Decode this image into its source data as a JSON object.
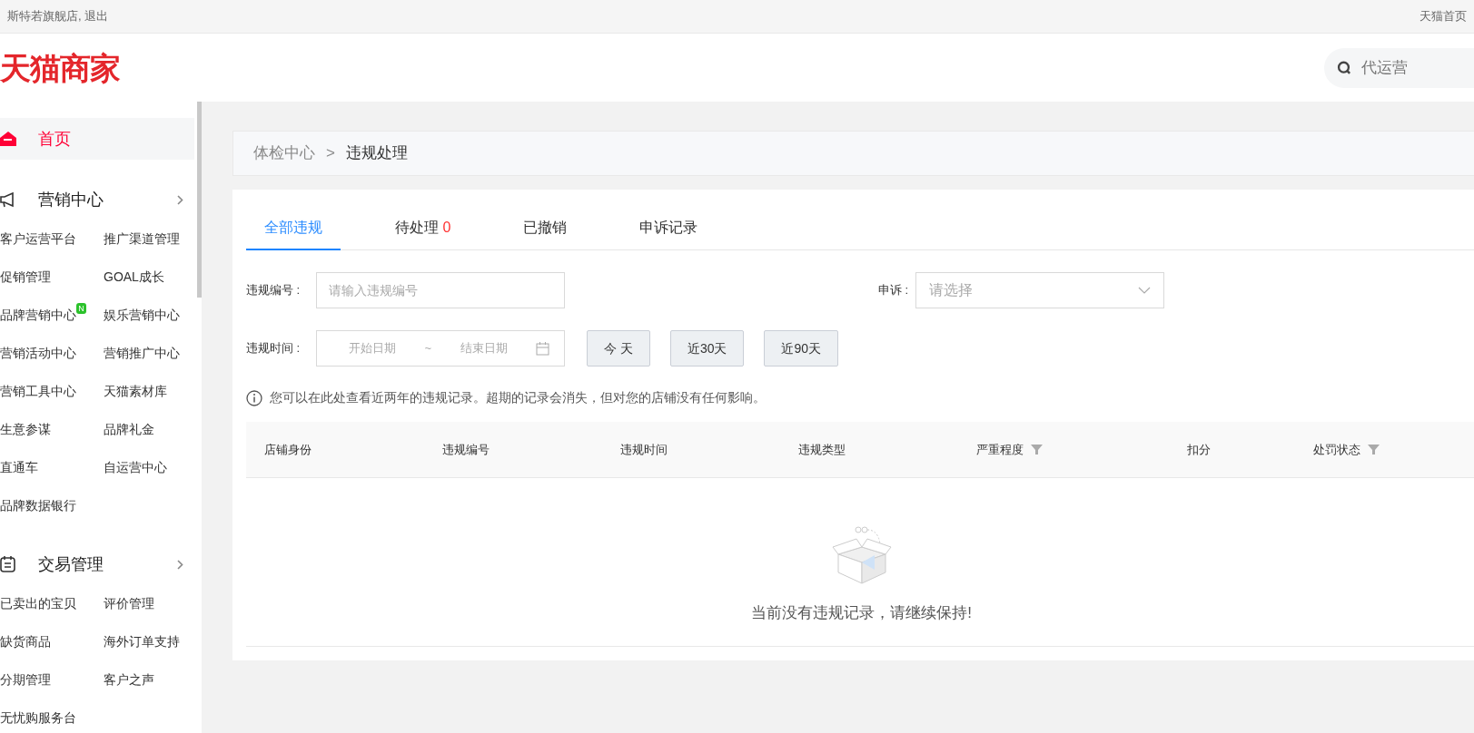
{
  "top_bar": {
    "account_text": "斯特若旗舰店, 退出",
    "links": [
      "天猫首页"
    ]
  },
  "header": {
    "logo": "天猫商家",
    "search": {
      "placeholder": "代运营"
    }
  },
  "sidebar": {
    "items": [
      {
        "kind": "link",
        "label": "首页",
        "selected": true
      },
      {
        "kind": "section",
        "label": "营销中心",
        "children": [
          {
            "label": "客户运营平台"
          },
          {
            "label": "推广渠道管理"
          },
          {
            "label": "促销管理"
          },
          {
            "label": "GOAL成长"
          },
          {
            "label": "品牌营销中心",
            "badge": "N"
          },
          {
            "label": "娱乐营销中心"
          },
          {
            "label": "营销活动中心"
          },
          {
            "label": "营销推广中心"
          },
          {
            "label": "营销工具中心"
          },
          {
            "label": "天猫素材库"
          },
          {
            "label": "生意参谋"
          },
          {
            "label": "品牌礼金"
          },
          {
            "label": "直通车"
          },
          {
            "label": "自运营中心"
          },
          {
            "label": "品牌数据银行"
          }
        ]
      },
      {
        "kind": "section",
        "label": "交易管理",
        "children": [
          {
            "label": "已卖出的宝贝"
          },
          {
            "label": "评价管理"
          },
          {
            "label": "缺货商品"
          },
          {
            "label": "海外订单支持"
          },
          {
            "label": "分期管理"
          },
          {
            "label": "客户之声"
          },
          {
            "label": "无忧购服务台"
          }
        ]
      }
    ]
  },
  "breadcrumb": {
    "items": [
      "体检中心",
      "违规处理"
    ],
    "separator": ">"
  },
  "tabs": [
    {
      "label": "全部违规",
      "selected": true
    },
    {
      "label": "待处理",
      "count": "0",
      "selected": false
    },
    {
      "label": "已撤销",
      "selected": false
    },
    {
      "label": "申诉记录",
      "selected": false
    }
  ],
  "filters": {
    "violation_number": {
      "label": "违规编号 :",
      "placeholder": "请输入违规编号"
    },
    "appeal": {
      "label": "申诉 :",
      "placeholder": "请选择"
    },
    "violation_time": {
      "label": "违规时间 :",
      "start_placeholder": "开始日期",
      "separator": "~",
      "end_placeholder": "结束日期"
    },
    "quick_ranges": [
      "今 天",
      "近30天",
      "近90天"
    ]
  },
  "notice": "您可以在此处查看近两年的违规记录。超期的记录会消失，但对您的店铺没有任何影响。",
  "table": {
    "columns": [
      {
        "label": "店铺身份",
        "filter": false
      },
      {
        "label": "违规编号",
        "filter": false
      },
      {
        "label": "违规时间",
        "filter": false
      },
      {
        "label": "违规类型",
        "filter": false
      },
      {
        "label": "严重程度",
        "filter": true
      },
      {
        "label": "扣分",
        "filter": false
      },
      {
        "label": "处罚状态",
        "filter": true
      }
    ],
    "empty_text": "当前没有违规记录，请继续保持!"
  }
}
